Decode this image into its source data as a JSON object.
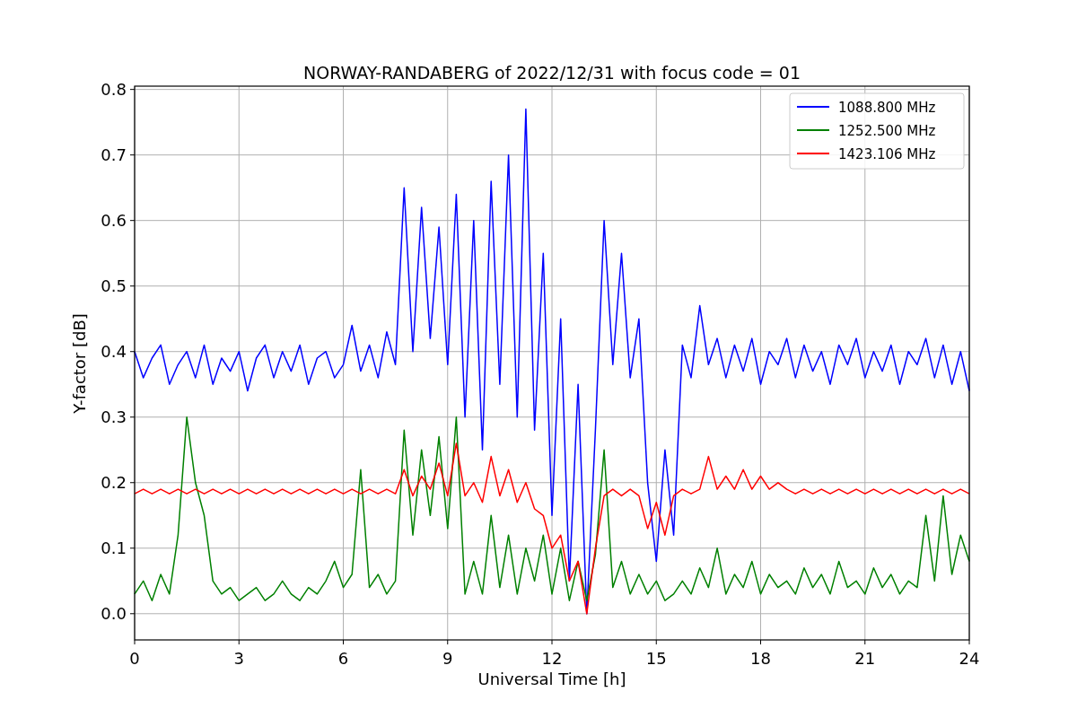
{
  "figure": {
    "chart_data": {
      "type": "line",
      "title": "NORWAY-RANDABERG of 2022/12/31 with focus code = 01",
      "xlabel": "Universal Time [h]",
      "ylabel": "Y-factor [dB]",
      "grid": true,
      "legend": "upper right",
      "xlim": [
        0,
        24
      ],
      "ylim": [
        -0.04,
        0.805
      ],
      "xticks": [
        0,
        3,
        6,
        9,
        12,
        15,
        18,
        21,
        24
      ],
      "yticks": [
        {
          "value": 0,
          "label": "0.0"
        },
        {
          "value": 0.1,
          "label": "0.1"
        },
        {
          "value": 0.2,
          "label": "0.2"
        },
        {
          "value": 0.3,
          "label": "0.3"
        },
        {
          "value": 0.4,
          "label": "0.4"
        },
        {
          "value": 0.5,
          "label": "0.5"
        },
        {
          "value": 0.6,
          "label": "0.6"
        },
        {
          "value": 0.7,
          "label": "0.7"
        },
        {
          "value": 0.8,
          "label": "0.8"
        }
      ],
      "x": [
        0,
        0.25,
        0.5,
        0.75,
        1,
        1.25,
        1.5,
        1.75,
        2,
        2.25,
        2.5,
        2.75,
        3,
        3.25,
        3.5,
        3.75,
        4,
        4.25,
        4.5,
        4.75,
        5,
        5.25,
        5.5,
        5.75,
        6,
        6.25,
        6.5,
        6.75,
        7,
        7.25,
        7.5,
        7.75,
        8,
        8.25,
        8.5,
        8.75,
        9,
        9.25,
        9.5,
        9.75,
        10,
        10.25,
        10.5,
        10.75,
        11,
        11.25,
        11.5,
        11.75,
        12,
        12.25,
        12.5,
        12.75,
        13,
        13.25,
        13.5,
        13.75,
        14,
        14.25,
        14.5,
        14.75,
        15,
        15.25,
        15.5,
        15.75,
        16,
        16.25,
        16.5,
        16.75,
        17,
        17.25,
        17.5,
        17.75,
        18,
        18.25,
        18.5,
        18.75,
        19,
        19.25,
        19.5,
        19.75,
        20,
        20.25,
        20.5,
        20.75,
        21,
        21.25,
        21.5,
        21.75,
        22,
        22.25,
        22.5,
        22.75,
        23,
        23.25,
        23.5,
        23.75,
        24
      ],
      "series": [
        {
          "name": "1088.800 MHz",
          "color": "#0000ff",
          "values": [
            0.4,
            0.36,
            0.39,
            0.41,
            0.35,
            0.38,
            0.4,
            0.36,
            0.41,
            0.35,
            0.39,
            0.37,
            0.4,
            0.34,
            0.39,
            0.41,
            0.36,
            0.4,
            0.37,
            0.41,
            0.35,
            0.39,
            0.4,
            0.36,
            0.38,
            0.44,
            0.37,
            0.41,
            0.36,
            0.43,
            0.38,
            0.65,
            0.4,
            0.62,
            0.42,
            0.59,
            0.38,
            0.64,
            0.3,
            0.6,
            0.25,
            0.66,
            0.35,
            0.7,
            0.3,
            0.77,
            0.28,
            0.55,
            0.15,
            0.45,
            0.05,
            0.35,
            0.0,
            0.28,
            0.6,
            0.38,
            0.55,
            0.36,
            0.45,
            0.2,
            0.08,
            0.25,
            0.12,
            0.41,
            0.36,
            0.47,
            0.38,
            0.42,
            0.36,
            0.41,
            0.37,
            0.42,
            0.35,
            0.4,
            0.38,
            0.42,
            0.36,
            0.41,
            0.37,
            0.4,
            0.35,
            0.41,
            0.38,
            0.42,
            0.36,
            0.4,
            0.37,
            0.41,
            0.35,
            0.4,
            0.38,
            0.42,
            0.36,
            0.41,
            0.35,
            0.4,
            0.34
          ]
        },
        {
          "name": "1252.500 MHz",
          "color": "#008000",
          "values": [
            0.03,
            0.05,
            0.02,
            0.06,
            0.03,
            0.12,
            0.3,
            0.2,
            0.15,
            0.05,
            0.03,
            0.04,
            0.02,
            0.03,
            0.04,
            0.02,
            0.03,
            0.05,
            0.03,
            0.02,
            0.04,
            0.03,
            0.05,
            0.08,
            0.04,
            0.06,
            0.22,
            0.04,
            0.06,
            0.03,
            0.05,
            0.28,
            0.12,
            0.25,
            0.15,
            0.27,
            0.13,
            0.3,
            0.03,
            0.08,
            0.03,
            0.15,
            0.04,
            0.12,
            0.03,
            0.1,
            0.05,
            0.12,
            0.03,
            0.1,
            0.02,
            0.08,
            0.02,
            0.09,
            0.25,
            0.04,
            0.08,
            0.03,
            0.06,
            0.03,
            0.05,
            0.02,
            0.03,
            0.05,
            0.03,
            0.07,
            0.04,
            0.1,
            0.03,
            0.06,
            0.04,
            0.08,
            0.03,
            0.06,
            0.04,
            0.05,
            0.03,
            0.07,
            0.04,
            0.06,
            0.03,
            0.08,
            0.04,
            0.05,
            0.03,
            0.07,
            0.04,
            0.06,
            0.03,
            0.05,
            0.04,
            0.15,
            0.05,
            0.18,
            0.06,
            0.12,
            0.08
          ]
        },
        {
          "name": "1423.106 MHz",
          "color": "#ff0000",
          "values": [
            0.183,
            0.19,
            0.183,
            0.19,
            0.183,
            0.19,
            0.183,
            0.19,
            0.183,
            0.19,
            0.183,
            0.19,
            0.183,
            0.19,
            0.183,
            0.19,
            0.183,
            0.19,
            0.183,
            0.19,
            0.183,
            0.19,
            0.183,
            0.19,
            0.183,
            0.19,
            0.183,
            0.19,
            0.183,
            0.19,
            0.183,
            0.22,
            0.18,
            0.21,
            0.19,
            0.23,
            0.18,
            0.26,
            0.18,
            0.2,
            0.17,
            0.24,
            0.18,
            0.22,
            0.17,
            0.2,
            0.16,
            0.15,
            0.1,
            0.12,
            0.05,
            0.08,
            0.0,
            0.1,
            0.18,
            0.19,
            0.18,
            0.19,
            0.18,
            0.13,
            0.17,
            0.12,
            0.18,
            0.19,
            0.183,
            0.19,
            0.24,
            0.19,
            0.21,
            0.19,
            0.22,
            0.19,
            0.21,
            0.19,
            0.2,
            0.19,
            0.183,
            0.19,
            0.183,
            0.19,
            0.183,
            0.19,
            0.183,
            0.19,
            0.183,
            0.19,
            0.183,
            0.19,
            0.183,
            0.19,
            0.183,
            0.19,
            0.183,
            0.19,
            0.183,
            0.19,
            0.183
          ]
        }
      ]
    }
  }
}
